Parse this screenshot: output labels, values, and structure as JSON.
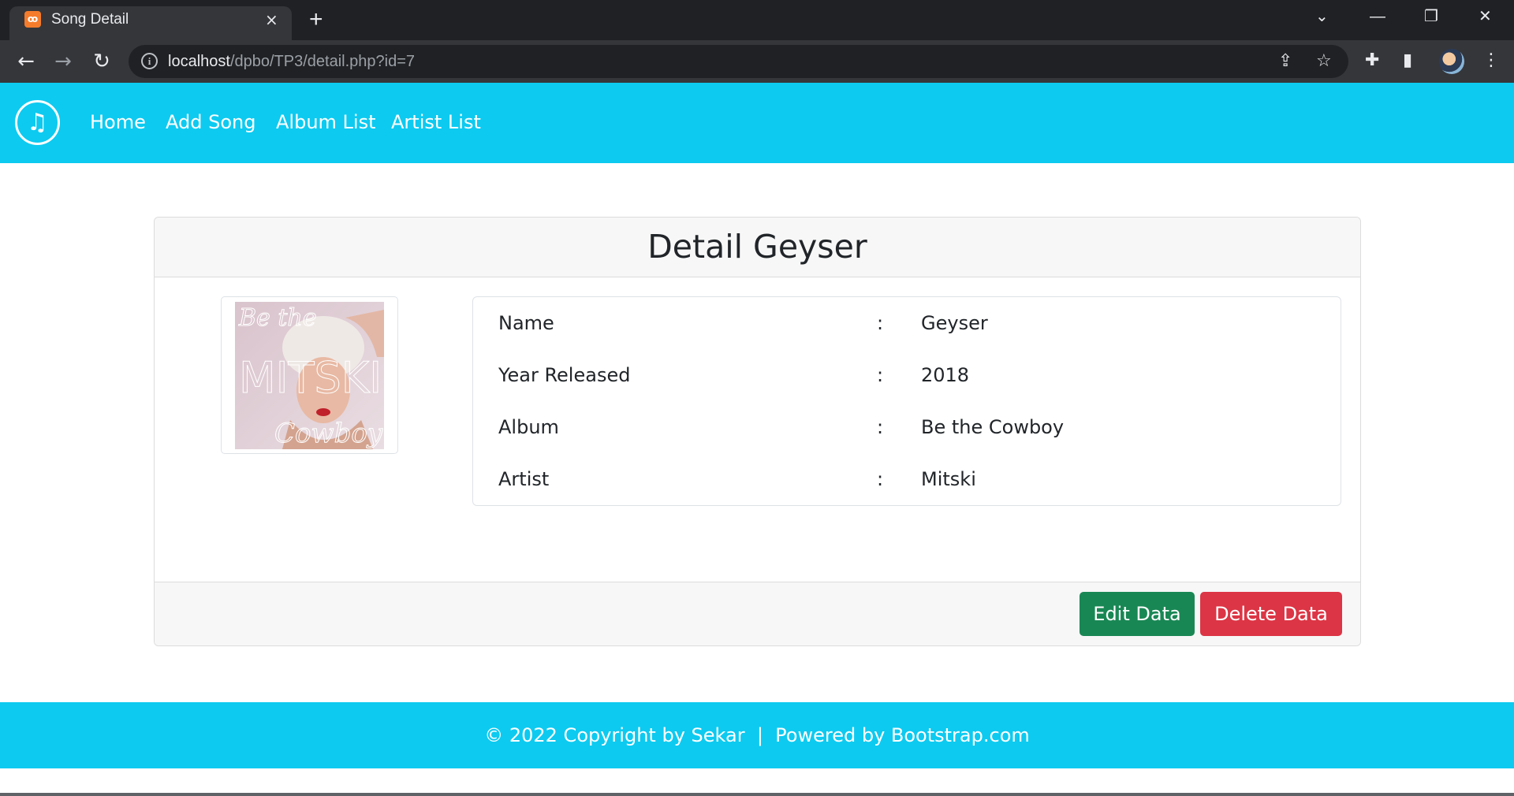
{
  "browser": {
    "tab_title": "Song Detail",
    "tab_favicon": "xampp-icon",
    "tab_close": "×",
    "new_tab": "+",
    "window_controls": {
      "minimize": "—",
      "restore": "❐",
      "close": "✕",
      "tabs_menu": "⌄"
    },
    "nav": {
      "back": "←",
      "forward": "→",
      "reload": "↻"
    },
    "url_host": "localhost",
    "url_path": "/dpbo/TP3/detail.php?id=7",
    "icons": [
      "info-icon",
      "share-icon",
      "star-icon",
      "extensions-icon",
      "side-panel-icon",
      "profile-avatar",
      "menu-icon"
    ]
  },
  "navbar": {
    "logo_icon": "music-note-icon",
    "logo_glyph": "♫",
    "links": [
      {
        "label": "Home"
      },
      {
        "label": "Add Song"
      },
      {
        "label": "Album List"
      },
      {
        "label": "Artist List"
      }
    ]
  },
  "card": {
    "title": "Detail Geyser",
    "album_art_alt": "Be the Cowboy album cover",
    "details": [
      {
        "label": "Name",
        "sep": ":",
        "value": "Geyser"
      },
      {
        "label": "Year Released",
        "sep": ":",
        "value": "2018"
      },
      {
        "label": "Album",
        "sep": ":",
        "value": "Be the Cowboy"
      },
      {
        "label": "Artist",
        "sep": ":",
        "value": "Mitski"
      }
    ],
    "buttons": {
      "edit": "Edit Data",
      "delete": "Delete Data"
    }
  },
  "footer": {
    "text": "© 2022 Copyright by Sekar  |  Powered by Bootstrap.com"
  },
  "colors": {
    "brand": "#0dcaf0",
    "edit": "#198754",
    "delete": "#dc3545",
    "chrome_dark": "#202124",
    "chrome_mid": "#35363a"
  }
}
